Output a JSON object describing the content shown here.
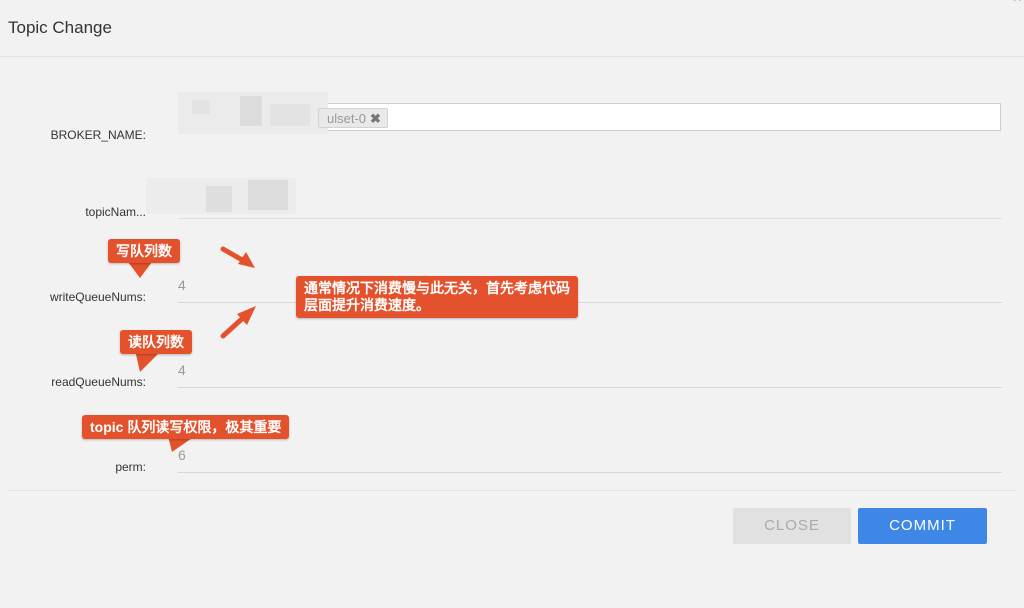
{
  "dialog": {
    "title": "Topic Change"
  },
  "form": {
    "broker_name": {
      "label": "BROKER_NAME:",
      "tag_value": "ulset-0",
      "tag_remove": "✖"
    },
    "topic_name": {
      "label": "topicNam..."
    },
    "write_queue_nums": {
      "label": "writeQueueNums:",
      "value": "4"
    },
    "read_queue_nums": {
      "label": "readQueueNums:",
      "value": "4"
    },
    "perm": {
      "label": "perm:",
      "value": "6"
    }
  },
  "buttons": {
    "close": "CLOSE",
    "commit": "COMMIT"
  },
  "annotations": {
    "write_queue": "写队列数",
    "read_queue": "读队列数",
    "perm_note": "topic 队列读写权限，极其重要",
    "main_note_line1": "通常情况下消费慢与此无关，首先考虑代码",
    "main_note_line2": "层面提升消费速度。"
  },
  "colors": {
    "annotation": "#e3522c",
    "commit_button": "#3e87e6"
  }
}
